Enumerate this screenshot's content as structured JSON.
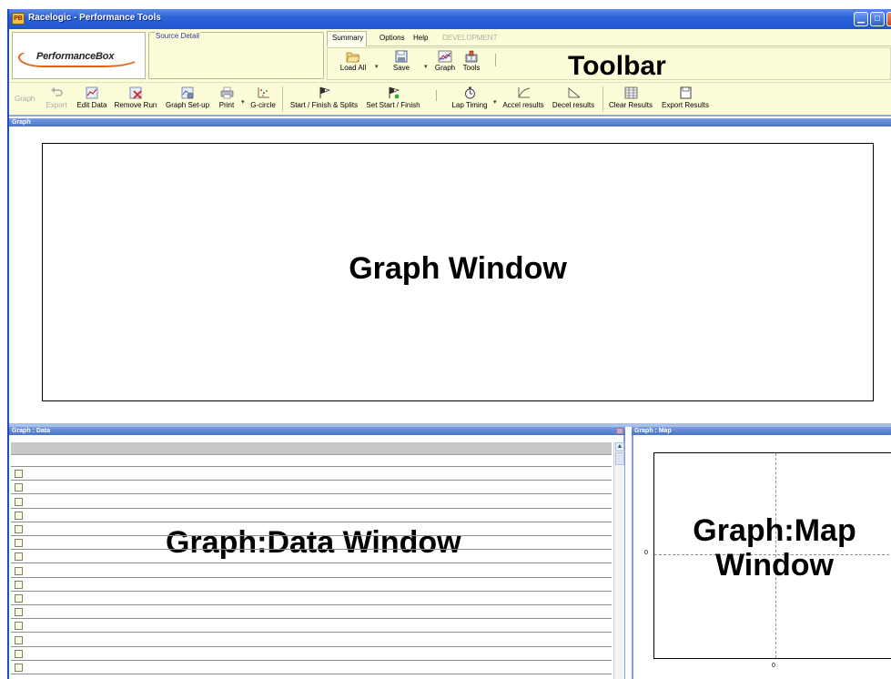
{
  "window": {
    "title": "Racelogic - Performance Tools",
    "icon": "app-icon",
    "controls": {
      "minimize": "▁",
      "maximize": "□",
      "close": "✕"
    }
  },
  "logo": {
    "text": "PerformanceBox"
  },
  "source_detail": {
    "label": "Source Detail"
  },
  "menu": {
    "items": [
      {
        "label": "Summary"
      },
      {
        "label": "Options"
      },
      {
        "label": "Help"
      },
      {
        "label": "DEVELOPMENT"
      }
    ]
  },
  "ribbon": {
    "load_all": "Load All",
    "save": "Save",
    "graph": "Graph",
    "tools": "Tools"
  },
  "toolbar_annotation": "Toolbar",
  "toolbar2": {
    "graph": "Graph",
    "export": "Export",
    "edit_data": "Edit Data",
    "remove_run": "Remove Run",
    "graph_setup": "Graph Set-up",
    "print": "Print",
    "g_circle": "G-circle",
    "start_finish_splits": "Start / Finish & Splits",
    "set_start_finish": "Set Start / Finish",
    "lap_timing": "Lap Timing",
    "accel_results": "Accel results",
    "decel_results": "Decel results",
    "clear_results": "Clear Results",
    "export_results": "Export Results"
  },
  "panels": {
    "graph": {
      "header": "Graph",
      "label": "Graph Window"
    },
    "data": {
      "header": "Graph : Data",
      "label": "Graph:Data Window"
    },
    "map": {
      "header": "Graph : Map",
      "label": "Graph:Map Window",
      "y_tick": "0",
      "x_tick": "0"
    }
  },
  "colors": {
    "titlebar": "#2d63d8",
    "toolbar_bg": "#fdfcd8",
    "panel_header": "#4a72c8",
    "logo_accent": "#e0651a"
  }
}
